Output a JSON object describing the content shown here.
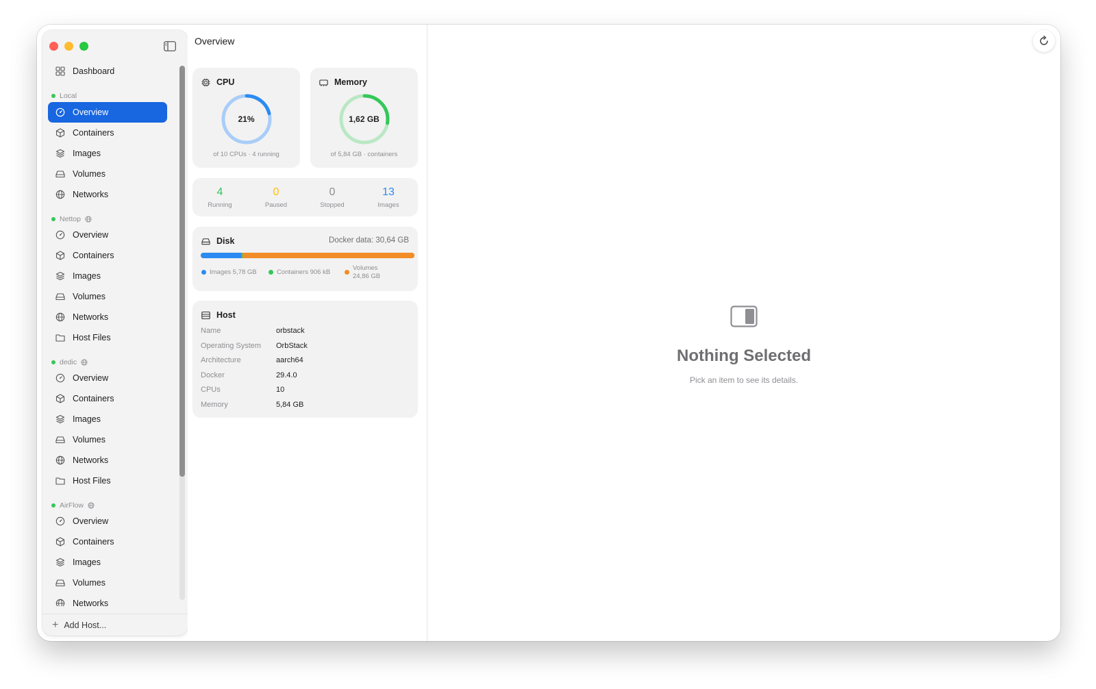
{
  "sidebar": {
    "dashboard_label": "Dashboard",
    "add_host_label": "Add Host...",
    "groups": {
      "local": {
        "name": "Local",
        "items": [
          "Overview",
          "Containers",
          "Images",
          "Volumes",
          "Networks"
        ]
      },
      "nettop": {
        "name": "Nettop",
        "items": [
          "Overview",
          "Containers",
          "Images",
          "Volumes",
          "Networks",
          "Host Files"
        ]
      },
      "dedic": {
        "name": "dedic",
        "items": [
          "Overview",
          "Containers",
          "Images",
          "Volumes",
          "Networks",
          "Host Files"
        ]
      },
      "airflow": {
        "name": "AirFlow",
        "items": [
          "Overview",
          "Containers",
          "Images",
          "Volumes",
          "Networks"
        ]
      }
    },
    "status_color": "#34c759",
    "active_color": "#1866e0"
  },
  "overview": {
    "title": "Overview",
    "cpu": {
      "title": "CPU",
      "value_label": "21%",
      "percent": 0.21,
      "subtitle": "of 10 CPUs · 4 running",
      "color": "#2b8bf2"
    },
    "memory": {
      "title": "Memory",
      "value_label": "1,62 GB",
      "fraction": 0.277,
      "subtitle": "of 5,84 GB · containers",
      "color": "#34c759"
    },
    "stats": {
      "running": {
        "value": "4",
        "label": "Running",
        "color": "#34c759"
      },
      "paused": {
        "value": "0",
        "label": "Paused",
        "color": "#ffc107"
      },
      "stopped": {
        "value": "0",
        "label": "Stopped",
        "color": "#8e8e93"
      },
      "images": {
        "value": "13",
        "label": "Images",
        "color": "#2b8bf2"
      }
    },
    "disk": {
      "title": "Disk",
      "docker_data": "Docker data: 30,64 GB",
      "images_fraction": 0.189,
      "containers_fraction": 0.003,
      "volumes_fraction": 0.808,
      "images_legend": "Images 5,78 GB",
      "containers_legend": "Containers 906 kB",
      "volumes_legend_label": "Volumes",
      "volumes_legend_value": "24,86 GB",
      "images_color": "#2b8bf2",
      "containers_color": "#34c759",
      "volumes_color": "#f28c28"
    },
    "host": {
      "title": "Host",
      "rows": [
        {
          "key": "Name",
          "value": "orbstack"
        },
        {
          "key": "Operating System",
          "value": "OrbStack"
        },
        {
          "key": "Architecture",
          "value": "aarch64"
        },
        {
          "key": "Docker",
          "value": "29.4.0"
        },
        {
          "key": "CPUs",
          "value": "10"
        },
        {
          "key": "Memory",
          "value": "5,84 GB"
        }
      ]
    }
  },
  "detail": {
    "empty_title": "Nothing Selected",
    "empty_subtitle": "Pick an item to see its details."
  }
}
